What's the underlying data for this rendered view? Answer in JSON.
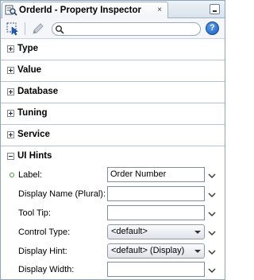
{
  "window": {
    "tab_title": "OrderId - Property Inspector",
    "close_glyph": "×"
  },
  "toolbar": {
    "search_placeholder": "",
    "help_label": "?"
  },
  "sections": [
    {
      "label": "Type",
      "expanded": false
    },
    {
      "label": "Value",
      "expanded": false
    },
    {
      "label": "Database",
      "expanded": false
    },
    {
      "label": "Tuning",
      "expanded": false
    },
    {
      "label": "Service",
      "expanded": false
    },
    {
      "label": "UI Hints",
      "expanded": true
    }
  ],
  "ui_hints": {
    "label": {
      "name": "Label:",
      "value": "Order Number",
      "required": true
    },
    "display_name_plural": {
      "name": "Display Name (Plural):",
      "value": ""
    },
    "tool_tip": {
      "name": "Tool Tip:",
      "value": ""
    },
    "control_type": {
      "name": "Control Type:",
      "value": "<default>"
    },
    "display_hint": {
      "name": "Display Hint:",
      "value": "<default> (Display)"
    },
    "display_width": {
      "name": "Display Width:",
      "value": ""
    }
  },
  "colors": {
    "accent": "#1b5fbf",
    "required_dot": "#3aa13a",
    "section_border": "#b7c3d3"
  }
}
